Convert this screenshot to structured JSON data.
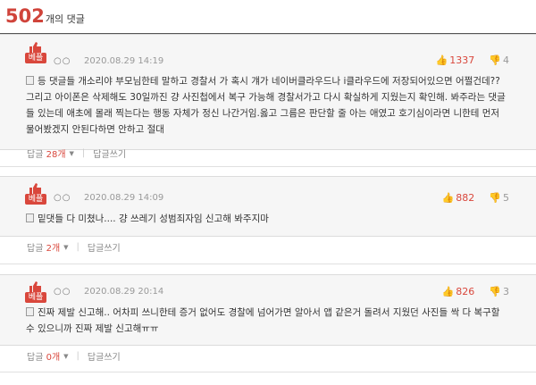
{
  "header": {
    "count": "502",
    "suffix": "개의 댓글"
  },
  "badge_label": "베플",
  "reply_label": "답글",
  "write_reply_label": "답글쓰기",
  "comments": [
    {
      "nick": "○○",
      "date": "2020.08.29 14:19",
      "up": "1337",
      "down": "4",
      "text": "등 댓글들 개소리야 부모님한테 말하고 경찰서 가 혹시 걔가 네이버클라우드나 i클라우드에 저장되어있으면 어쩔건데?? 그리고 아이폰은 삭제해도 30일까진 걍 사진첩에서 복구 가능해 경찰서가고 다시 확실하게 지웠는지 확인해. 봐주라는 댓글들 있는데 애초에 몰래 찍는다는 행동 자체가 정신 나간거임.옳고 그름은 판단할 줄 아는 애였고 호기심이라면 니한테 먼저 물어봤겠지 안된다하면 안하고 절대",
      "reply_count": "28개"
    },
    {
      "nick": "○○",
      "date": "2020.08.29 14:09",
      "up": "882",
      "down": "5",
      "text": "밑댓들 다 미쳤나.... 걍 쓰레기 성범죄자임 신고해 봐주지마",
      "reply_count": "2개"
    },
    {
      "nick": "○○",
      "date": "2020.08.29 20:14",
      "up": "826",
      "down": "3",
      "text": "진짜 제발 신고해.. 어차피 쓰니한테 증거 없어도 경찰에 넘어가면 알아서 앱 같은거 돌려서 지웠던 사진들 싹 다 복구할 수 있으니까 진짜 제발 신고해ㅠㅠ",
      "reply_count": "0개"
    }
  ]
}
